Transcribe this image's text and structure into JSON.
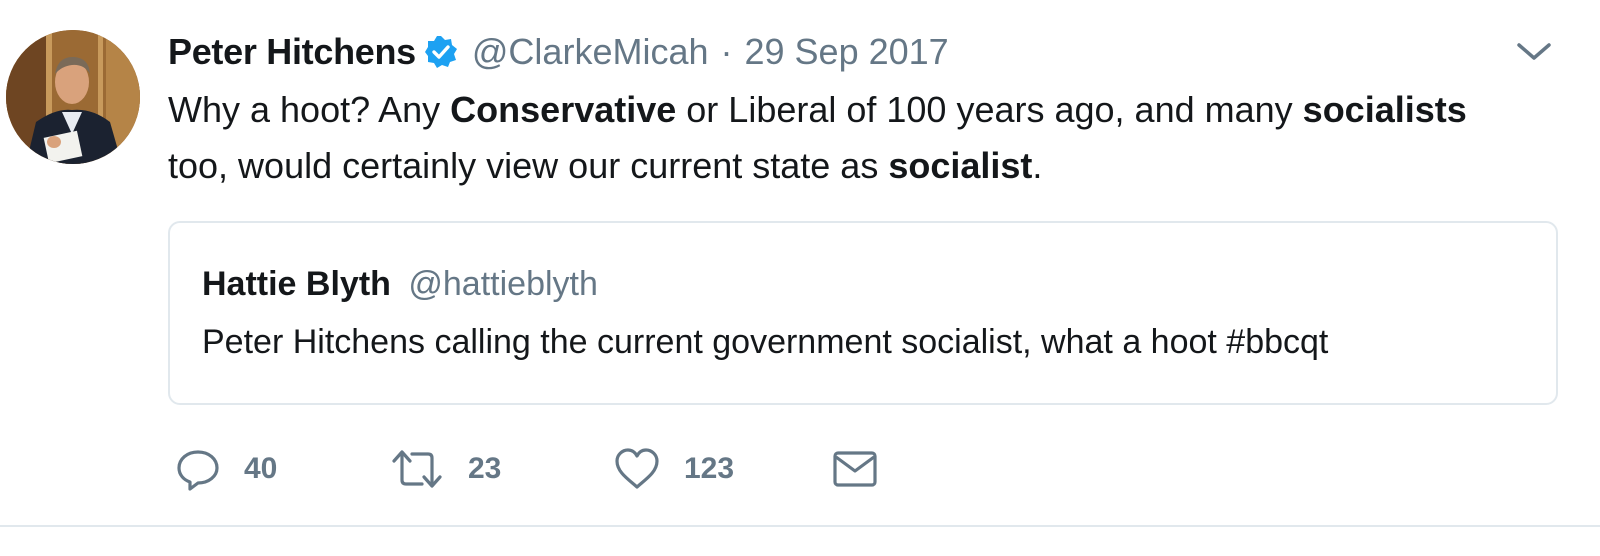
{
  "tweet": {
    "author_name": "Peter Hitchens",
    "handle": "@ClarkeMicah",
    "separator": "·",
    "date": "29 Sep 2017",
    "text": {
      "t1": "Why a hoot? Any ",
      "b1": "Conservative",
      "t2": " or Liberal of 100 years ago, and many ",
      "b2": "socialists",
      "t3": " too,  would certainly view our current state as ",
      "b3": "socialist",
      "t4": "."
    }
  },
  "quoted_tweet": {
    "author_name": "Hattie Blyth",
    "handle": "@hattieblyth",
    "text": "Peter Hitchens calling the current government socialist, what a hoot #bbcqt"
  },
  "actions": {
    "reply_count": "40",
    "retweet_count": "23",
    "like_count": "123"
  },
  "icons": {
    "verified": "verified-badge-icon",
    "caret": "chevron-down-icon",
    "reply": "reply-icon",
    "retweet": "retweet-icon",
    "like": "heart-icon",
    "dm": "envelope-icon"
  },
  "colors": {
    "verified_blue": "#1da1f2",
    "secondary_text": "#657786",
    "border": "#e1e8ed",
    "primary_text": "#14171a"
  }
}
